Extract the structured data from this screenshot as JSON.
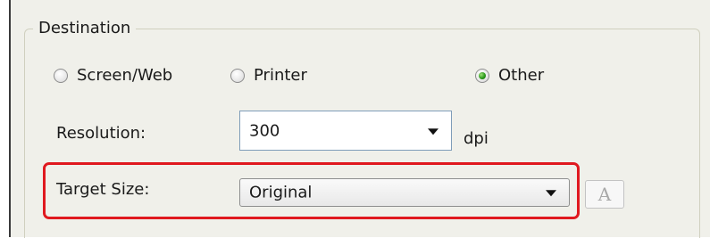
{
  "group": {
    "title": "Destination"
  },
  "destination": {
    "options": [
      {
        "label": "Screen/Web",
        "checked": false
      },
      {
        "label": "Printer",
        "checked": false
      },
      {
        "label": "Other",
        "checked": true
      }
    ]
  },
  "resolution": {
    "label": "Resolution:",
    "value": "300",
    "unit": "dpi"
  },
  "target_size": {
    "label": "Target Size:",
    "value": "Original"
  },
  "font_button": {
    "glyph": "A"
  },
  "colors": {
    "highlight": "#e0191f",
    "radio_selected": "#2a9a1a"
  }
}
